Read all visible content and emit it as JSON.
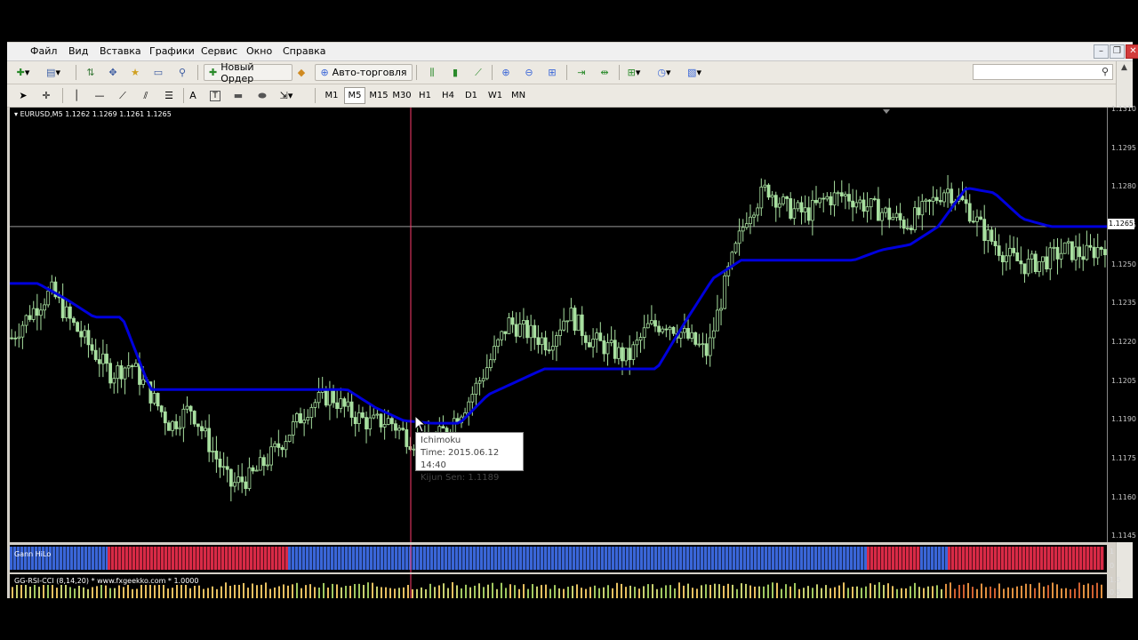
{
  "menu": {
    "items": [
      "Файл",
      "Вид",
      "Вставка",
      "Графики",
      "Сервис",
      "Окно",
      "Справка"
    ]
  },
  "toolbar": {
    "new_order_label": "Новый Ордер",
    "auto_trading_label": "Авто-торговля"
  },
  "timeframes": {
    "items": [
      "M1",
      "M5",
      "M15",
      "M30",
      "H1",
      "H4",
      "D1",
      "W1",
      "MN"
    ],
    "active": "M5"
  },
  "chart": {
    "symbol_header": "EURUSD,M5  1.1262 1.1269 1.1261 1.1265",
    "current_price": "1.1265",
    "price_axis": [
      "1.1310",
      "1.1295",
      "1.1280",
      "1.1265",
      "1.1250",
      "1.1235",
      "1.1220",
      "1.1205",
      "1.1190",
      "1.1175",
      "1.1160",
      "1.1145"
    ],
    "indicator_name": "Ichimoku",
    "tooltip": {
      "title": "Ichimoku",
      "time": "Time: 2015.06.12 14:40",
      "value": "Kijun Sen: 1.1189"
    }
  },
  "gann": {
    "label": "Gann HiLo",
    "axis_top": "1",
    "axis_bottom": "0"
  },
  "rsi": {
    "label": "GG-RSI-CCI (8,14,20) *  www.fxgeekko.com *  1.0000",
    "axis_top": "1.5",
    "axis_bottom": "0.5"
  },
  "chart_data": {
    "type": "candlestick",
    "series": [
      {
        "name": "EURUSD,M5",
        "values": [
          1.1222,
          1.1232,
          1.124,
          1.1228,
          1.1218,
          1.1208,
          1.1212,
          1.12,
          1.1188,
          1.1195,
          1.118,
          1.1165,
          1.1168,
          1.1176,
          1.1186,
          1.1196,
          1.12,
          1.1193,
          1.1189,
          1.119,
          1.1183,
          1.118,
          1.1188,
          1.1198,
          1.1212,
          1.1228,
          1.1224,
          1.122,
          1.1232,
          1.1222,
          1.1218,
          1.1214,
          1.1226,
          1.1228,
          1.1222,
          1.1216,
          1.1246,
          1.127,
          1.128,
          1.1272,
          1.127,
          1.1276,
          1.1277,
          1.1273,
          1.127,
          1.1266,
          1.1272,
          1.128,
          1.1273,
          1.1262,
          1.1254,
          1.125,
          1.1252,
          1.1256,
          1.1254,
          1.1258
        ]
      },
      {
        "name": "Ichimoku Kijun Sen",
        "values": [
          1.1243,
          1.1243,
          1.1237,
          1.123,
          1.123,
          1.1202,
          1.1202,
          1.1202,
          1.1202,
          1.1202,
          1.1202,
          1.1202,
          1.1202,
          1.1195,
          1.119,
          1.1189,
          1.1189,
          1.12,
          1.1205,
          1.121,
          1.121,
          1.121,
          1.121,
          1.121,
          1.1228,
          1.1245,
          1.1252,
          1.1252,
          1.1252,
          1.1252,
          1.1252,
          1.1256,
          1.1258,
          1.1265,
          1.128,
          1.1278,
          1.1268,
          1.1265,
          1.1265,
          1.1265
        ]
      }
    ],
    "xlabel": "",
    "ylabel": "",
    "ylim": [
      1.1143,
      1.1311
    ],
    "grid": false
  },
  "colors": {
    "bull_candle": "#a8e0a0",
    "kijun_line": "#0000dd",
    "crosshair": "#ff3c6e",
    "gann_red": "#d82a46",
    "gann_blue": "#3a66d8"
  }
}
